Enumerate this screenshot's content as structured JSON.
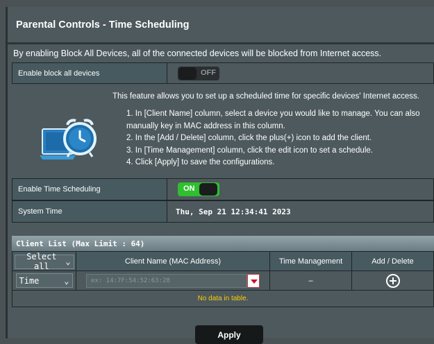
{
  "header": {
    "title": "Parental Controls - Time Scheduling",
    "description": "By enabling Block All Devices, all of the connected devices will be blocked from Internet access."
  },
  "block_all": {
    "label": "Enable block all devices",
    "state": "OFF"
  },
  "info": {
    "lead": "This feature allows you to set up a scheduled time for specific devices' Internet access.",
    "steps": [
      "1. In [Client Name] column, select a device you would like to manage. You can also manually key in MAC address in this column.",
      "2. In the [Add / Delete] column, click the plus(+) icon to add the client.",
      "3. In [Time Management] column, click the edit icon to set a schedule.",
      "4. Click [Apply] to save the configurations."
    ],
    "icon": "alarm-clock-laptop-icon"
  },
  "time_scheduling": {
    "label": "Enable Time Scheduling",
    "state": "ON"
  },
  "system_time": {
    "label": "System Time",
    "value": "Thu, Sep 21 12:34:41 2023"
  },
  "client_list": {
    "title": "Client List (Max Limit : 64)",
    "headers": {
      "select": "Select all",
      "client_name": "Client Name (MAC Address)",
      "time_management": "Time Management",
      "add_delete": "Add / Delete"
    },
    "input_row": {
      "mode": "Time",
      "mac_placeholder": "ex: 14:7F:54:52:63:28",
      "time_management": "–"
    },
    "empty_text": "No data in table."
  },
  "apply_label": "Apply",
  "colors": {
    "on": "#2fbf2f",
    "accent_red": "#c8102e",
    "no_data": "#ffcc00"
  }
}
